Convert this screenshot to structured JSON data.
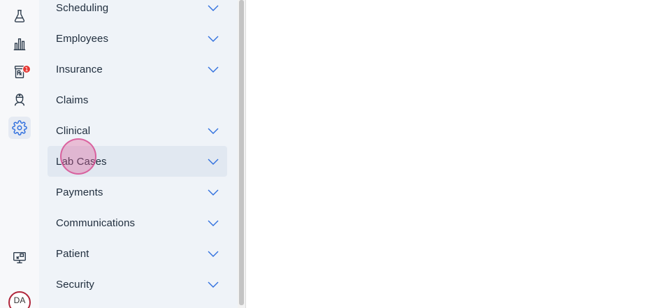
{
  "accent_color": "#2f6fde",
  "rail": {
    "icons": [
      {
        "name": "lab-flask-icon"
      },
      {
        "name": "reports-chart-icon"
      },
      {
        "name": "prescription-icon",
        "badge": "1"
      },
      {
        "name": "provider-icon"
      },
      {
        "name": "settings-gear-icon",
        "active": true
      },
      {
        "name": "remote-desktop-icon"
      }
    ],
    "avatar_initials": "DA"
  },
  "menu": {
    "items": [
      {
        "label": "Scheduling",
        "expandable": true
      },
      {
        "label": "Employees",
        "expandable": true
      },
      {
        "label": "Insurance",
        "expandable": true
      },
      {
        "label": "Claims",
        "expandable": false
      },
      {
        "label": "Clinical",
        "expandable": true
      },
      {
        "label": "Lab Cases",
        "expandable": true,
        "hovered": true
      },
      {
        "label": "Payments",
        "expandable": true
      },
      {
        "label": "Communications",
        "expandable": true
      },
      {
        "label": "Patient",
        "expandable": true
      },
      {
        "label": "Security",
        "expandable": true
      }
    ]
  }
}
